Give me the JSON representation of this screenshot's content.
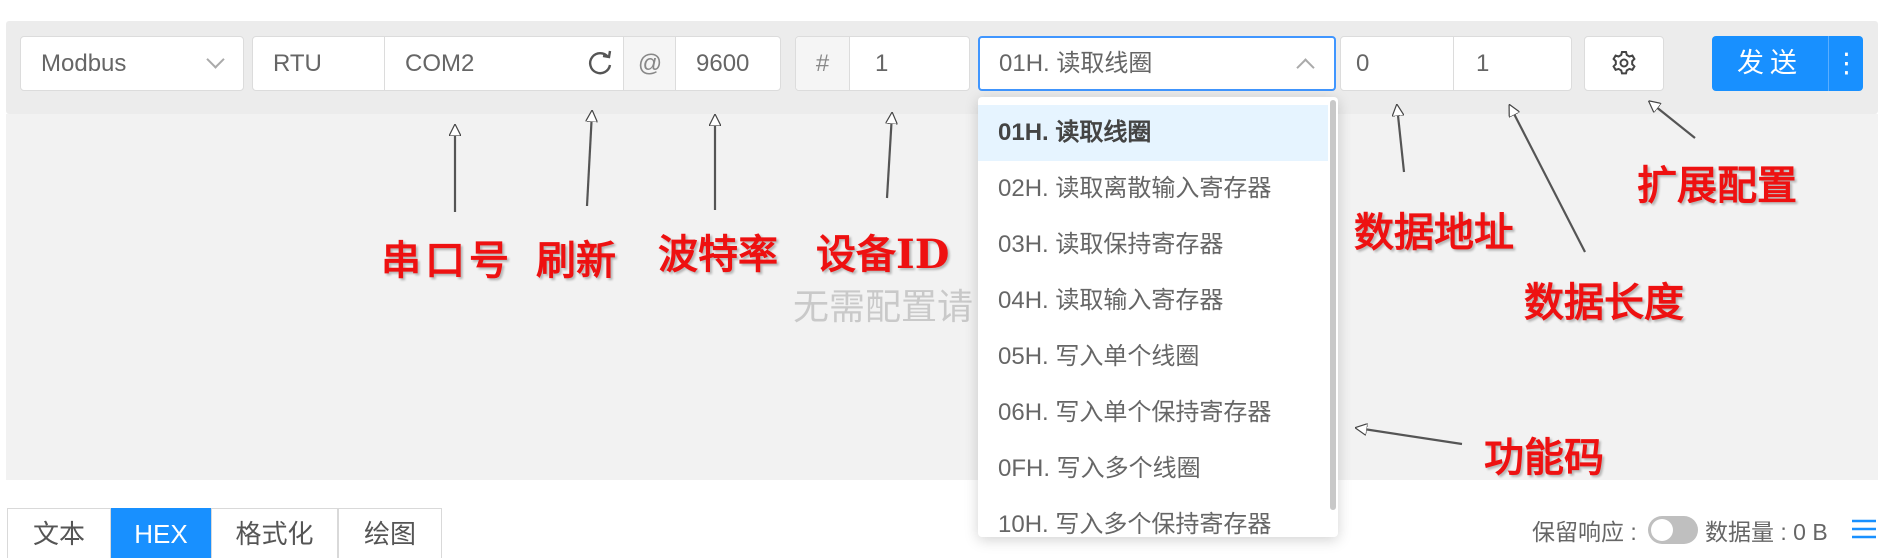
{
  "toolbar": {
    "protocol": "Modbus",
    "mode": "RTU",
    "port": "COM2",
    "at_symbol": "@",
    "baud_rate": "9600",
    "hash_symbol": "#",
    "device_id": "1",
    "function_code_selected": "01H. 读取线圈",
    "data_address": "0",
    "data_length": "1",
    "send_label": "发送"
  },
  "function_codes": [
    "01H. 读取线圈",
    "02H. 读取离散输入寄存器",
    "03H. 读取保持寄存器",
    "04H. 读取输入寄存器",
    "05H. 写入单个线圈",
    "06H. 写入单个保持寄存器",
    "0FH. 写入多个线圈",
    "10H. 写入多个保持寄存器"
  ],
  "placeholder": "无需配置请",
  "annotations": {
    "port": "串口号",
    "refresh": "刷新",
    "baud": "波特率",
    "device_id": "设备ID",
    "data_address": "数据地址",
    "data_length": "数据长度",
    "ext_config": "扩展配置",
    "function_code": "功能码"
  },
  "tabs": [
    "文本",
    "HEX",
    "格式化",
    "绘图"
  ],
  "active_tab": "HEX",
  "status": {
    "keep_response": "保留响应 :",
    "data_size": "数据量 : 0 B"
  },
  "icons": {
    "refresh": "refresh-icon",
    "settings": "gear-icon",
    "menu": "menu-icon",
    "more": "more-vertical-icon"
  },
  "colors": {
    "primary": "#1890ff",
    "annotation": "#ee1111",
    "selected_item_bg": "#e6f4ff"
  }
}
